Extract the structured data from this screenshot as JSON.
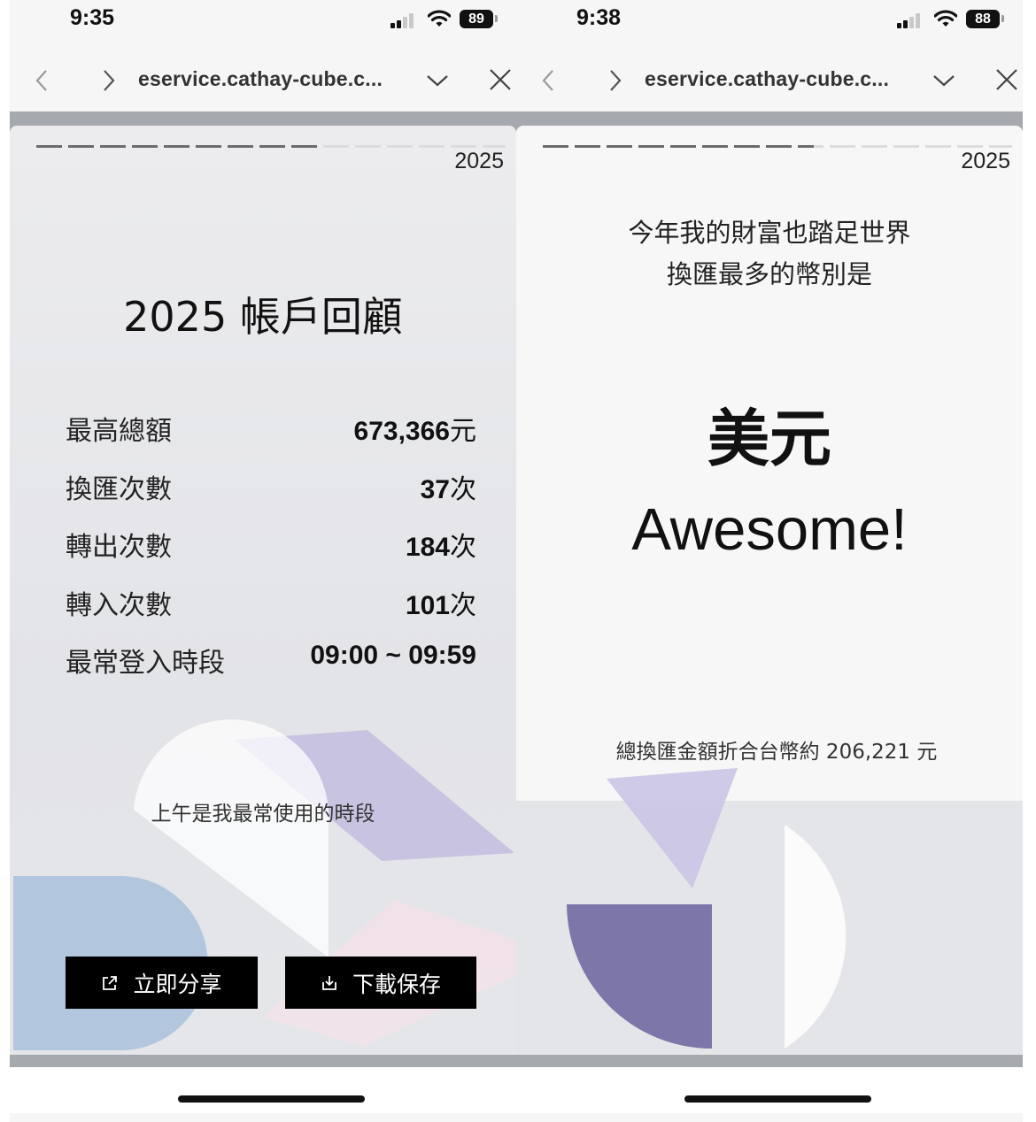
{
  "left": {
    "status": {
      "time": "9:35",
      "battery": "89"
    },
    "browser": {
      "url": "eservice.cathay-cube.c..."
    },
    "year": "2025",
    "title": "2025 帳戶回顧",
    "stats": [
      {
        "label": "最高總額",
        "value": "673,366",
        "unit": "元"
      },
      {
        "label": "換匯次數",
        "value": "37",
        "unit": "次"
      },
      {
        "label": "轉出次數",
        "value": "184",
        "unit": "次"
      },
      {
        "label": "轉入次數",
        "value": "101",
        "unit": "次"
      },
      {
        "label": "最常登入時段",
        "value": "09:00 ~ 09:59",
        "unit": ""
      }
    ],
    "caption": "上午是我最常使用的時段",
    "buttons": {
      "share": "立即分享",
      "save": "下載保存"
    }
  },
  "right": {
    "status": {
      "time": "9:38",
      "battery": "88"
    },
    "browser": {
      "url": "eservice.cathay-cube.c..."
    },
    "year": "2025",
    "question_line1": "今年我的財富也踏足世界",
    "question_line2": "換匯最多的幣別是",
    "currency": "美元",
    "exclaim": "Awesome!",
    "total": "總換匯金額折合台幣約 206,221 元"
  },
  "colors": {
    "lavender": "#b9b3d8",
    "purple": "#7d76a8",
    "blue": "#a9c1dc",
    "pink": "#f3e2ea",
    "button_bg": "#000000"
  },
  "icons": [
    "back-icon",
    "forward-icon",
    "chevron-down-icon",
    "close-icon",
    "share-icon",
    "download-icon",
    "wifi-icon",
    "signal-icon",
    "battery-icon"
  ]
}
